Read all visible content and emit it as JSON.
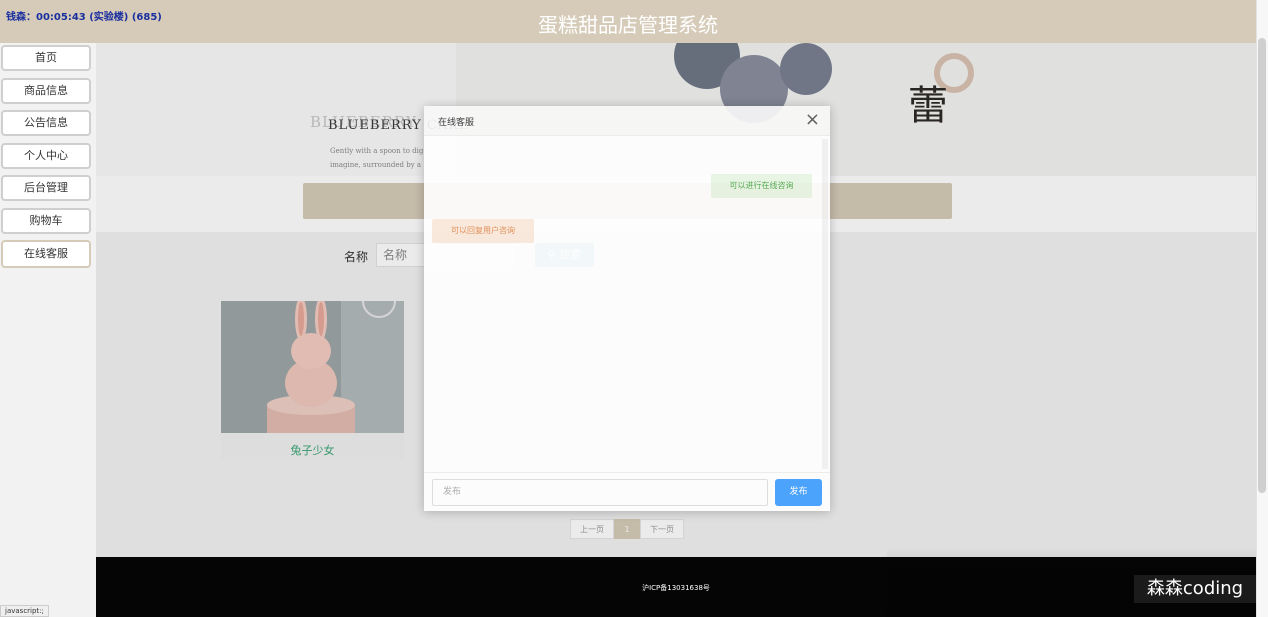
{
  "header": {
    "title": "蛋糕甜品店管理系统",
    "clock": "钱森：00:05:43 (实验楼) (685)"
  },
  "sidebar": {
    "items": [
      {
        "label": "首页"
      },
      {
        "label": "商品信息"
      },
      {
        "label": "公告信息"
      },
      {
        "label": "个人中心"
      },
      {
        "label": "后台管理"
      },
      {
        "label": "购物车"
      },
      {
        "label": "在线客服"
      }
    ]
  },
  "banner": {
    "heading": "BLUEBERRY CAKE",
    "heading_ghost": "BLUEBERRY",
    "line1": "Gently with a spoon to dig",
    "line2": "imagine, surrounded by a",
    "char_main": "蕾"
  },
  "search": {
    "label": "名称",
    "placeholder": "名称",
    "button_label": "搜索"
  },
  "products": [
    {
      "name": "兔子少女"
    }
  ],
  "pagination": {
    "prev": "上一页",
    "current": "1",
    "next": "下一页"
  },
  "footer": {
    "icp": "沪ICP备13031638号"
  },
  "chat_modal": {
    "title": "在线客服",
    "close_glyph": "×",
    "messages": [
      {
        "side": "right",
        "text": "可以进行在线咨询"
      },
      {
        "side": "left",
        "text": "可以回复用户咨询"
      }
    ],
    "input_placeholder": "发布",
    "send_label": "发布"
  },
  "status_bar": {
    "link": "javascript:;"
  },
  "watermark": {
    "text": "森森coding"
  },
  "colors": {
    "header_bg": "#d6cbb8",
    "primary_blue": "#409eff",
    "product_name": "#3aa676",
    "footer_bg": "#050505"
  }
}
